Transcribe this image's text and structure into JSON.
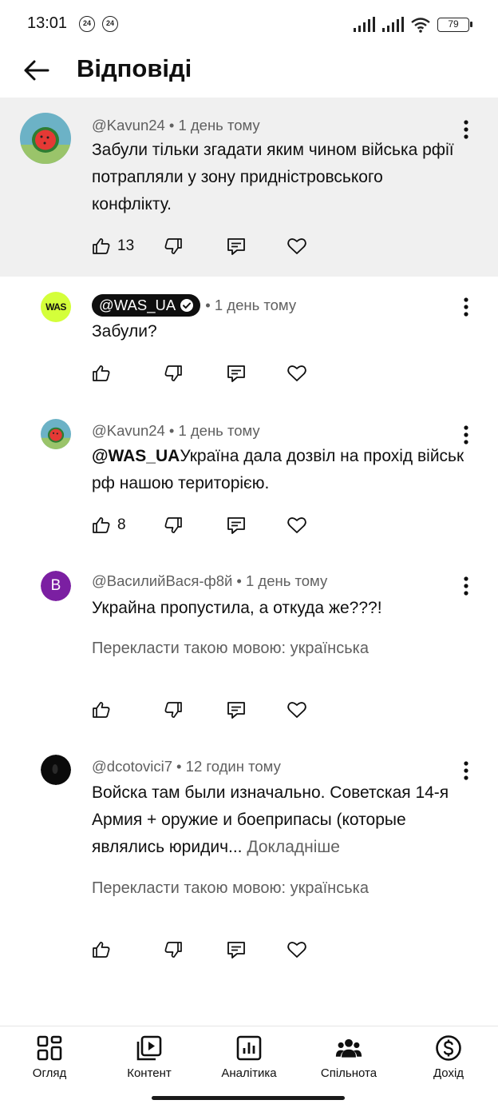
{
  "status_bar": {
    "time": "13:01",
    "badges": [
      "24",
      "24"
    ],
    "battery": "79",
    "icons": [
      "signal-icon",
      "signal-icon",
      "wifi-icon",
      "battery-icon"
    ]
  },
  "header": {
    "title": "Відповіді",
    "back_icon": "arrow-left-icon"
  },
  "comments": [
    {
      "author": "@Kavun24",
      "time": "• 1 день тому",
      "text": "Забули тільки згадати яким чином війська рфії потрапляли у зону придністровського конфлікту.",
      "likes": "13",
      "avatar": "watermelon"
    },
    {
      "author": "@WAS_UA",
      "verified": true,
      "time": "• 1 день тому",
      "text": "Забули?",
      "likes": "",
      "avatar_text": "WAS"
    },
    {
      "author": "@Kavun24",
      "time": "• 1 день тому",
      "mention": "@WAS_UA",
      "text": "Україна дала дозвіл на прохід військ рф нашою територією.",
      "likes": "8",
      "avatar": "watermelon"
    },
    {
      "author": "@ВасилийВася-ф8й",
      "time": "• 1 день тому",
      "text": "Украйна пропустила, а откуда же???!",
      "translate": "Перекласти такою мовою: українська",
      "likes": "",
      "avatar_letter": "В",
      "avatar_color": "#7b1fa2"
    },
    {
      "author": "@dcotovici7",
      "time": "• 12 годин тому",
      "text": "Войска там были изначально. Советская 14-я Армия + оружие и боеприпасы (которые являлись юридич...",
      "more": "Докладніше",
      "translate": "Перекласти такою мовою: українська",
      "likes": "",
      "avatar": "dark"
    }
  ],
  "bottom_nav": {
    "items": [
      {
        "label": "Огляд",
        "icon": "dashboard-icon"
      },
      {
        "label": "Контент",
        "icon": "video-library-icon"
      },
      {
        "label": "Аналітика",
        "icon": "analytics-icon"
      },
      {
        "label": "Спільнота",
        "icon": "community-icon",
        "active": true
      },
      {
        "label": "Дохід",
        "icon": "dollar-icon"
      }
    ]
  },
  "colors": {
    "highlight_bg": "#f0f0f0",
    "meta_text": "#606060",
    "was_avatar": "#d4ff3a",
    "purple_avatar": "#7b1fa2"
  }
}
